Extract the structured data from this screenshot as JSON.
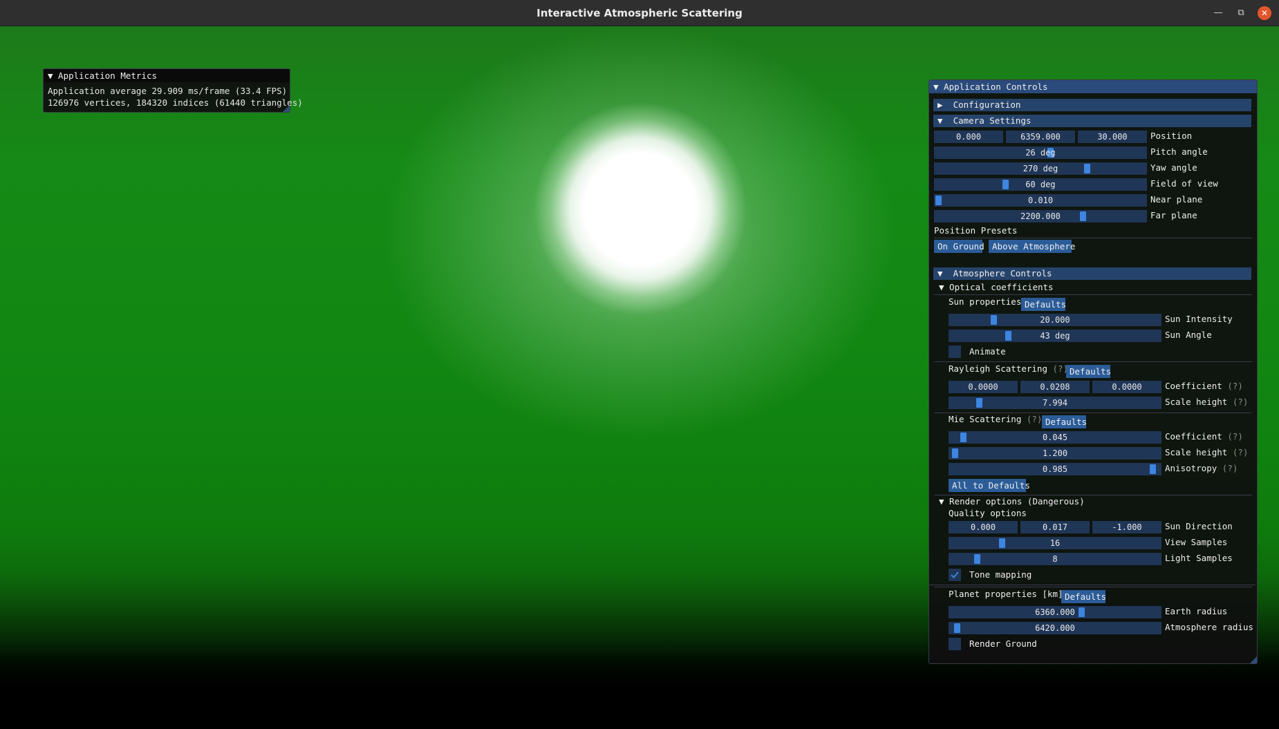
{
  "window": {
    "title": "Interactive Atmospheric Scattering"
  },
  "metrics": {
    "title": "▼ Application Metrics",
    "line1": "Application average 29.909 ms/frame (33.4 FPS)",
    "line2": "126976 vertices, 184320 indices (61440 triangles)"
  },
  "controls": {
    "title": "▼ Application Controls",
    "configuration": "▶  Configuration",
    "camera": {
      "header": "▼  Camera Settings",
      "position": [
        "0.000",
        "6359.000",
        "30.000"
      ],
      "position_label": "Position",
      "pitch": "26 deg",
      "pitch_label": "Pitch angle",
      "yaw": "270 deg",
      "yaw_label": "Yaw angle",
      "fov": "60 deg",
      "fov_label": "Field of view",
      "near": "0.010",
      "near_label": "Near plane",
      "far": "2200.000",
      "far_label": "Far plane",
      "presets_label": "Position Presets",
      "preset_ground": "On Ground",
      "preset_above": "Above Atmosphere"
    },
    "atmosphere": {
      "header": "▼  Atmosphere Controls",
      "optical": "▼ Optical coefficients",
      "sun_props": "Sun properties",
      "defaults": "Defaults",
      "sun_intensity": "20.000",
      "sun_intensity_label": "Sun Intensity",
      "sun_angle": "43 deg",
      "sun_angle_label": "Sun Angle",
      "animate_label": "Animate",
      "rayleigh": "Rayleigh Scattering",
      "help": "(?)",
      "rayleigh_coef": [
        "0.0000",
        "0.0208",
        "0.0000"
      ],
      "coefficient_label": "Coefficient",
      "rayleigh_scale": "7.994",
      "scale_height_label": "Scale height",
      "mie": "Mie Scattering",
      "mie_coef": "0.045",
      "mie_scale": "1.200",
      "mie_aniso": "0.985",
      "anisotropy_label": "Anisotropy",
      "all_defaults": "All to Defaults",
      "render_opts": "▼ Render options (Dangerous)",
      "quality": "Quality options",
      "sun_dir": [
        "0.000",
        "0.017",
        "-1.000"
      ],
      "sun_dir_label": "Sun Direction",
      "view_samples": "16",
      "view_samples_label": "View Samples",
      "light_samples": "8",
      "light_samples_label": "Light Samples",
      "tone_label": "Tone mapping",
      "planet": "Planet properties [km]",
      "earth_radius": "6360.000",
      "earth_radius_label": "Earth radius",
      "atmo_radius": "6420.000",
      "atmo_radius_label": "Atmosphere radius",
      "render_ground_label": "Render Ground"
    }
  },
  "sliders": {
    "pitch": 0.55,
    "yaw": 0.73,
    "fov": 0.33,
    "near": 0.0,
    "far": 0.71,
    "sun_intensity": 0.2,
    "sun_angle": 0.27,
    "rayleigh_scale": 0.13,
    "mie_coef": 0.05,
    "mie_scale": 0.01,
    "mie_aniso": 0.98,
    "view_samples": 0.24,
    "light_samples": 0.12,
    "earth_radius": 0.63,
    "atmo_radius": 0.02
  },
  "toggles": {
    "animate": false,
    "tone_mapping": true,
    "render_ground": false
  },
  "colors": {
    "grab": "#3d85e0",
    "frame": "#203657",
    "button": "#2b5c98",
    "header": "#26436b"
  }
}
